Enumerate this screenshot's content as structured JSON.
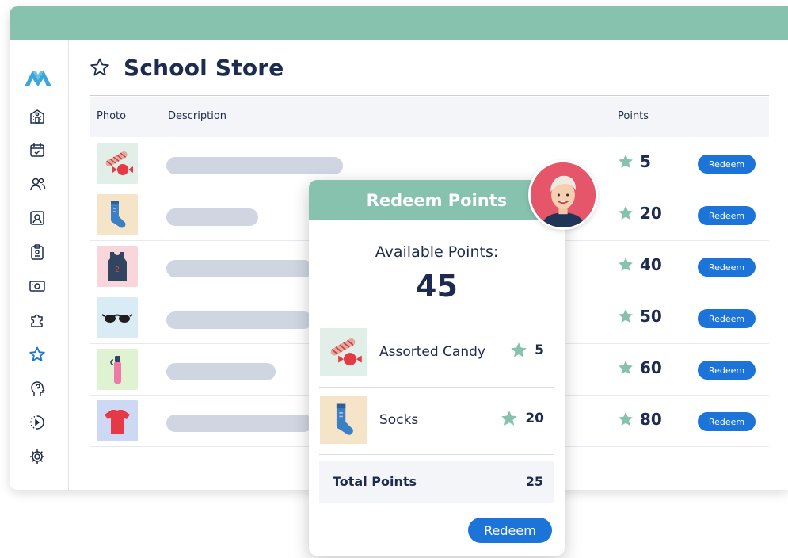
{
  "app": {
    "brand_color": "#86c2ae",
    "accent_color": "#1c74d9"
  },
  "sidebar": {
    "logo": "mountain-logo",
    "items": [
      {
        "icon": "school-icon"
      },
      {
        "icon": "calendar-check-icon"
      },
      {
        "icon": "users-icon"
      },
      {
        "icon": "id-card-icon"
      },
      {
        "icon": "clipboard-icon"
      },
      {
        "icon": "money-icon"
      },
      {
        "icon": "puzzle-icon"
      },
      {
        "icon": "star-icon",
        "active": true
      },
      {
        "icon": "head-icon"
      },
      {
        "icon": "progress-icon"
      },
      {
        "icon": "gear-icon"
      }
    ]
  },
  "page": {
    "title": "School Store",
    "title_icon": "star-icon"
  },
  "table": {
    "headers": {
      "photo": "Photo",
      "description": "Description",
      "points": "Points"
    },
    "rows": [
      {
        "item": "candy",
        "points": "5",
        "action": "Redeem"
      },
      {
        "item": "socks",
        "points": "20",
        "action": "Redeem"
      },
      {
        "item": "jersey",
        "points": "40",
        "action": "Redeem"
      },
      {
        "item": "sunglasses",
        "points": "50",
        "action": "Redeem"
      },
      {
        "item": "water-bottle",
        "points": "60",
        "action": "Redeem"
      },
      {
        "item": "t-shirt",
        "points": "80",
        "action": "Redeem"
      }
    ]
  },
  "modal": {
    "title": "Redeem Points",
    "available_label": "Available Points:",
    "available_value": "45",
    "items": [
      {
        "name": "Assorted Candy",
        "points": "5"
      },
      {
        "name": "Socks",
        "points": "20"
      }
    ],
    "total_label": "Total Points",
    "total_value": "25",
    "redeem_label": "Redeem"
  }
}
